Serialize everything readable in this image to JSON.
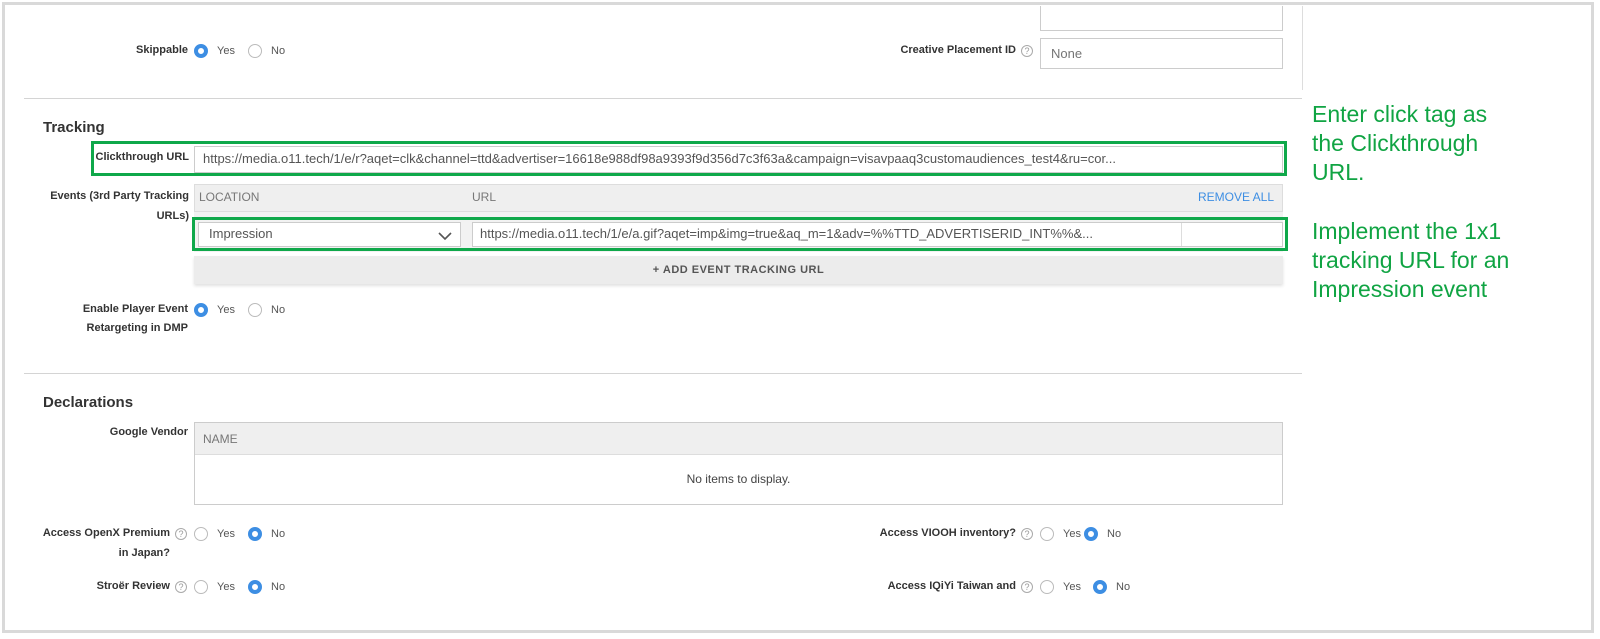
{
  "skippable": {
    "label": "Skippable",
    "yes": "Yes",
    "no": "No",
    "selected": "Yes"
  },
  "creative_placement": {
    "label": "Creative Placement ID",
    "placeholder": "None"
  },
  "tracking": {
    "title": "Tracking",
    "clickthrough_label": "Clickthrough URL",
    "clickthrough_value": "https://media.o11.tech/1/e/r?aqet=clk&channel=ttd&advertiser=16618e988df98a9393f9d356d7c3f63a&campaign=visavpaaq3customaudiences_test4&ru=cor...",
    "events_label": "Events (3rd Party Tracking URLs)",
    "col_location": "LOCATION",
    "col_url": "URL",
    "remove_all": "REMOVE ALL",
    "event_location": "Impression",
    "event_url": "https://media.o11.tech/1/e/a.gif?aqet=imp&img=true&aq_m=1&adv=%%TTD_ADVERTISERID_INT%%&...",
    "add_event": "+ ADD EVENT TRACKING URL",
    "enable_label": "Enable Player Event Retargeting in DMP",
    "enable_yes": "Yes",
    "enable_no": "No",
    "enable_selected": "Yes"
  },
  "declarations": {
    "title": "Declarations",
    "google_vendor_label": "Google Vendor",
    "col_name": "NAME",
    "empty_text": "No items to display.",
    "openx_label": "Access OpenX Premium in Japan?",
    "openx_selected": "No",
    "viooh_label": "Access VIOOH inventory?",
    "viooh_selected": "No",
    "stroer_label": "Stroër Review",
    "stroer_selected": "No",
    "iqiyi_label": "Access IQiYi Taiwan and",
    "iqiyi_selected": "No",
    "yes": "Yes",
    "no": "No"
  },
  "annotations": {
    "click_tag": "Enter click tag as the Clickthrough URL.",
    "impression": "Implement the 1x1 tracking URL for an Impression event"
  },
  "colors": {
    "accent_blue": "#3d8ee3",
    "highlight_green": "#0fa84a",
    "note_green": "#10a443"
  },
  "icons": {
    "help": "help-icon",
    "dropdown": "chevron-down-icon"
  }
}
